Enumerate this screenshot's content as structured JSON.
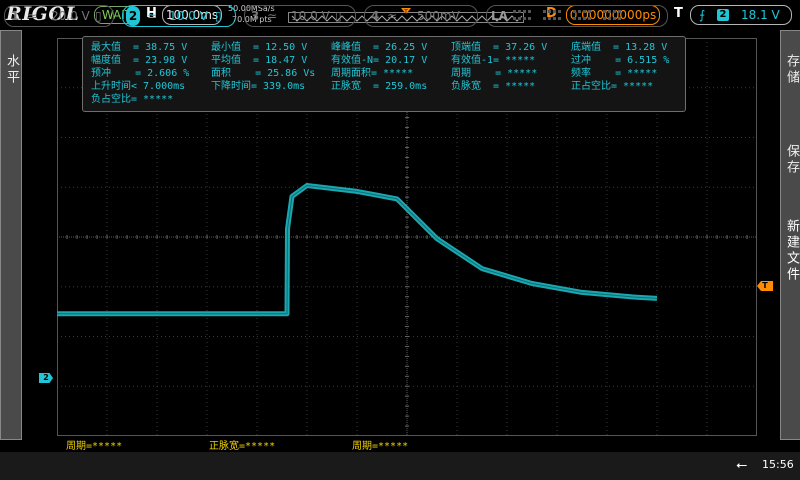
{
  "brand": "RIGOL",
  "status": "WAIT",
  "horizontal": {
    "label": "H",
    "timebase": "100.0ms",
    "sample_rate": "50.00MSa/s",
    "memory_depth": "70.0M pts"
  },
  "delay": {
    "label": "D",
    "value": "0.00000000ps"
  },
  "trigger": {
    "label": "T",
    "channel": "2",
    "level": "18.1 V"
  },
  "left_menu": {
    "label": "水平"
  },
  "right_menu": {
    "items": [
      "存储",
      "保存",
      "新建文件"
    ]
  },
  "measurements": {
    "rows": [
      [
        "最大值  = 38.75 V",
        "最小值  = 12.50 V",
        "峰峰值  = 26.25 V",
        "顶端值  = 37.26 V",
        "底端值  = 13.28 V"
      ],
      [
        "幅度值  = 23.98 V",
        "平均值  = 18.47 V",
        "有效值-N= 20.17 V",
        "有效值-1= *****",
        "过冲    = 6.515 %"
      ],
      [
        "预冲    = 2.606 %",
        "面积    = 25.86 Vs",
        "周期面积= *****",
        "周期    = *****",
        "频率    = *****"
      ],
      [
        "上升时间< 7.000ms",
        "下降时间= 339.0ms",
        "正脉宽  = 259.0ms",
        "负脉宽  = *****",
        "正占空比= *****"
      ],
      [
        "负占空比= *****"
      ]
    ]
  },
  "bottom_measurements": [
    "周期=*****",
    "正脉宽=*****",
    "周期=*****"
  ],
  "markers": {
    "trigger_marker": "T",
    "channel_marker": "2",
    "trigger_position": "T"
  },
  "channels": [
    {
      "num": "1",
      "scale": "20.0 V",
      "active": false
    },
    {
      "num": "2",
      "scale": "10.0 V",
      "active": true
    },
    {
      "num": "3",
      "scale": "10.0 V",
      "active": false
    },
    {
      "num": "4",
      "scale": "500mV",
      "active": false
    }
  ],
  "la": {
    "label": "LA"
  },
  "clock": "15:56",
  "colors": {
    "ch2": "#1aa7b0",
    "trigger": "#ff8c00",
    "grid": "#444444",
    "meas_text": "#20c6d6"
  },
  "waveform": {
    "description_channel": "2",
    "points_ms": [
      [
        0,
        12.9
      ],
      [
        460,
        12.9
      ],
      [
        461,
        30
      ],
      [
        470,
        36.5
      ],
      [
        500,
        38.7
      ],
      [
        600,
        37.5
      ],
      [
        680,
        36
      ],
      [
        760,
        28
      ],
      [
        850,
        22
      ],
      [
        950,
        19
      ],
      [
        1050,
        17.2
      ],
      [
        1150,
        16.3
      ],
      [
        1200,
        16
      ]
    ]
  }
}
